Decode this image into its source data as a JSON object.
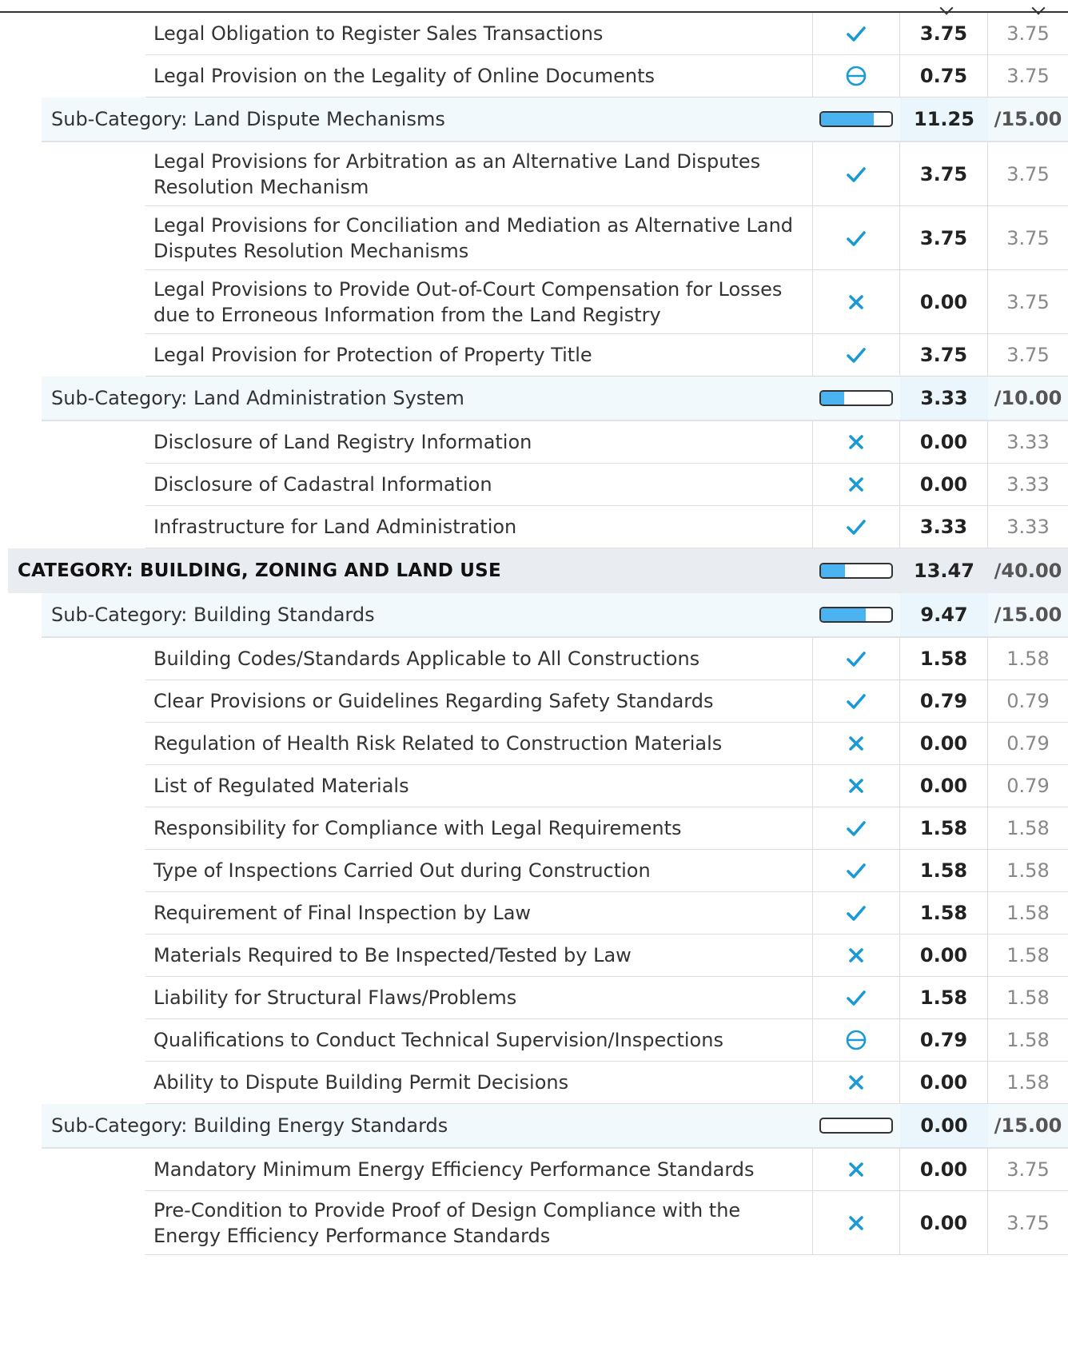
{
  "rows": [
    {
      "type": "item",
      "label": "Legal Obligation to Register Sales Transactions",
      "status": "check",
      "score": "3.75",
      "max": "3.75"
    },
    {
      "type": "item",
      "label": "Legal Provision on the Legality of Online Documents",
      "status": "partial",
      "score": "0.75",
      "max": "3.75"
    },
    {
      "type": "sub",
      "label": "Sub-Category: Land Dispute Mechanisms",
      "progress": 0.75,
      "score": "11.25",
      "max": "/15.00"
    },
    {
      "type": "item",
      "label": "Legal Provisions for Arbitration as an Alternative Land Disputes Resolution Mechanism",
      "status": "check",
      "score": "3.75",
      "max": "3.75"
    },
    {
      "type": "item",
      "label": "Legal Provisions for Conciliation and Mediation as Alternative Land Disputes Resolution Mechanisms",
      "status": "check",
      "score": "3.75",
      "max": "3.75"
    },
    {
      "type": "item",
      "label": "Legal Provisions to Provide Out-of-Court Compensation for Losses due to Erroneous Information from the Land Registry",
      "status": "cross",
      "score": "0.00",
      "max": "3.75"
    },
    {
      "type": "item",
      "label": "Legal Provision for Protection of Property Title",
      "status": "check",
      "score": "3.75",
      "max": "3.75"
    },
    {
      "type": "sub",
      "label": "Sub-Category: Land Administration System",
      "progress": 0.333,
      "score": "3.33",
      "max": "/10.00"
    },
    {
      "type": "item",
      "label": "Disclosure of Land Registry Information",
      "status": "cross",
      "score": "0.00",
      "max": "3.33"
    },
    {
      "type": "item",
      "label": "Disclosure of Cadastral Information",
      "status": "cross",
      "score": "0.00",
      "max": "3.33"
    },
    {
      "type": "item",
      "label": "Infrastructure for Land Administration",
      "status": "check",
      "score": "3.33",
      "max": "3.33"
    },
    {
      "type": "cat",
      "label": "CATEGORY: BUILDING, ZONING AND LAND USE",
      "progress": 0.337,
      "score": "13.47",
      "max": "/40.00"
    },
    {
      "type": "sub",
      "label": "Sub-Category: Building Standards",
      "progress": 0.631,
      "score": "9.47",
      "max": "/15.00"
    },
    {
      "type": "item",
      "label": "Building Codes/Standards Applicable to All Constructions",
      "status": "check",
      "score": "1.58",
      "max": "1.58"
    },
    {
      "type": "item",
      "label": "Clear Provisions or Guidelines Regarding Safety Standards",
      "status": "check",
      "score": "0.79",
      "max": "0.79"
    },
    {
      "type": "item",
      "label": "Regulation of Health Risk Related to Construction Materials",
      "status": "cross",
      "score": "0.00",
      "max": "0.79"
    },
    {
      "type": "item",
      "label": "List of Regulated Materials",
      "status": "cross",
      "score": "0.00",
      "max": "0.79"
    },
    {
      "type": "item",
      "label": "Responsibility for Compliance with Legal Requirements",
      "status": "check",
      "score": "1.58",
      "max": "1.58"
    },
    {
      "type": "item",
      "label": "Type of Inspections Carried Out during Construction",
      "status": "check",
      "score": "1.58",
      "max": "1.58"
    },
    {
      "type": "item",
      "label": "Requirement of Final Inspection by Law",
      "status": "check",
      "score": "1.58",
      "max": "1.58"
    },
    {
      "type": "item",
      "label": "Materials Required to Be Inspected/Tested by Law",
      "status": "cross",
      "score": "0.00",
      "max": "1.58"
    },
    {
      "type": "item",
      "label": "Liability for Structural Flaws/Problems",
      "status": "check",
      "score": "1.58",
      "max": "1.58"
    },
    {
      "type": "item",
      "label": "Qualifications to Conduct Technical Supervision/Inspections",
      "status": "partial",
      "score": "0.79",
      "max": "1.58"
    },
    {
      "type": "item",
      "label": "Ability to Dispute Building Permit Decisions",
      "status": "cross",
      "score": "0.00",
      "max": "1.58"
    },
    {
      "type": "sub",
      "label": "Sub-Category: Building Energy Standards",
      "progress": 0,
      "score": "0.00",
      "max": "/15.00"
    },
    {
      "type": "item",
      "label": "Mandatory Minimum Energy Efficiency Performance Standards",
      "status": "cross",
      "score": "0.00",
      "max": "3.75"
    },
    {
      "type": "item",
      "label": "Pre-Condition to Provide Proof of Design Compliance with the Energy Efficiency Performance Standards",
      "status": "cross",
      "score": "0.00",
      "max": "3.75"
    }
  ]
}
